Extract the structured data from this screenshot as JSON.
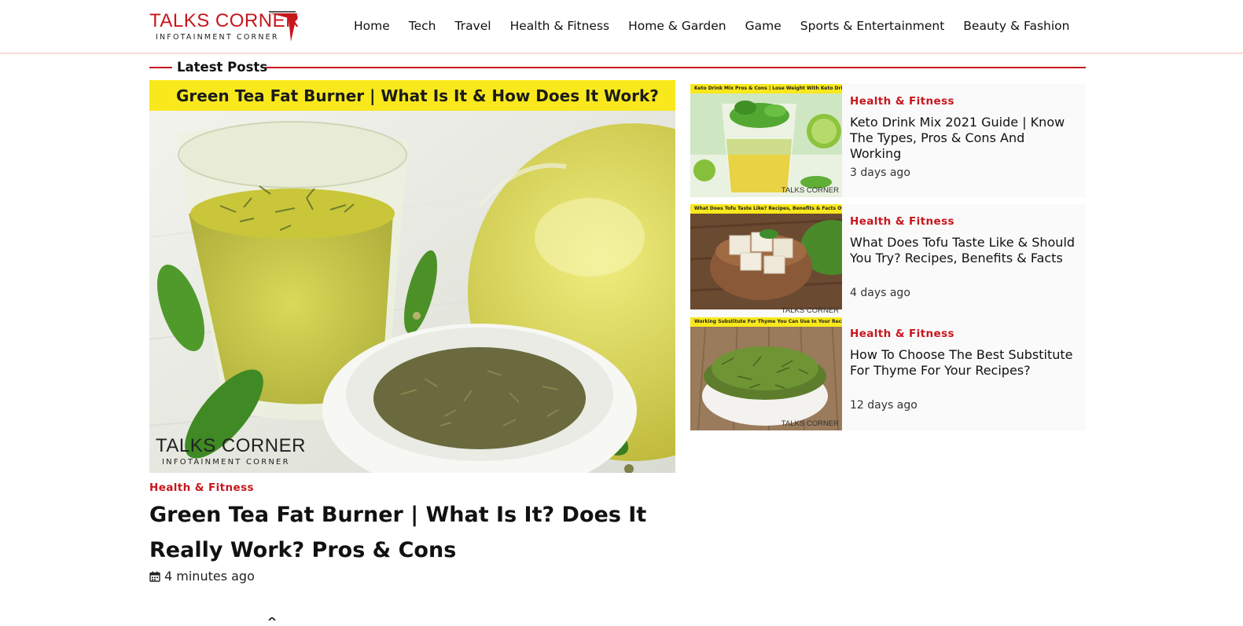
{
  "header": {
    "logo_main": "TALKS CORNER",
    "logo_sub": "INFOTAINMENT CORNER",
    "nav": [
      "Home",
      "Tech",
      "Travel",
      "Health & Fitness",
      "Home & Garden",
      "Game",
      "Sports & Entertainment",
      "Beauty & Fashion"
    ]
  },
  "section": {
    "title": "Latest Posts"
  },
  "featured": {
    "banner_text": "Green Tea Fat Burner | What Is It & How Does It Work?",
    "watermark_main": "TALKS CORNER",
    "watermark_sub": "INFOTAINMENT CORNER",
    "category": "Health & Fitness",
    "title": "Green Tea Fat Burner | What Is It? Does It Really Work? Pros & Cons",
    "time": "4 minutes ago",
    "icon": "calendar-icon"
  },
  "side_posts": [
    {
      "banner_text": "Keto Drink Mix Pros & Cons | Lose Weight With Keto Drinks",
      "watermark": "TALKS CORNER",
      "category": "Health & Fitness",
      "title": "Keto Drink Mix 2021 Guide | Know The Types, Pros & Cons And Working",
      "time": "3 days ago"
    },
    {
      "banner_text": "What Does Tofu Taste Like? Recipes, Benefits & Facts Of Tofu",
      "watermark": "TALKS CORNER",
      "category": "Health & Fitness",
      "title": "What Does Tofu Taste Like & Should You Try? Recipes, Benefits & Facts",
      "time": "4 days ago"
    },
    {
      "banner_text": "Working Substitute For Thyme You Can Use In Your Recipes ?",
      "watermark": "TALKS CORNER",
      "category": "Health & Fitness",
      "title": "How To Choose The Best Substitute For Thyme For Your Recipes?",
      "time": "12 days ago"
    }
  ],
  "colors": {
    "accent": "#c8161d",
    "banner_yellow": "#f9e81c"
  }
}
